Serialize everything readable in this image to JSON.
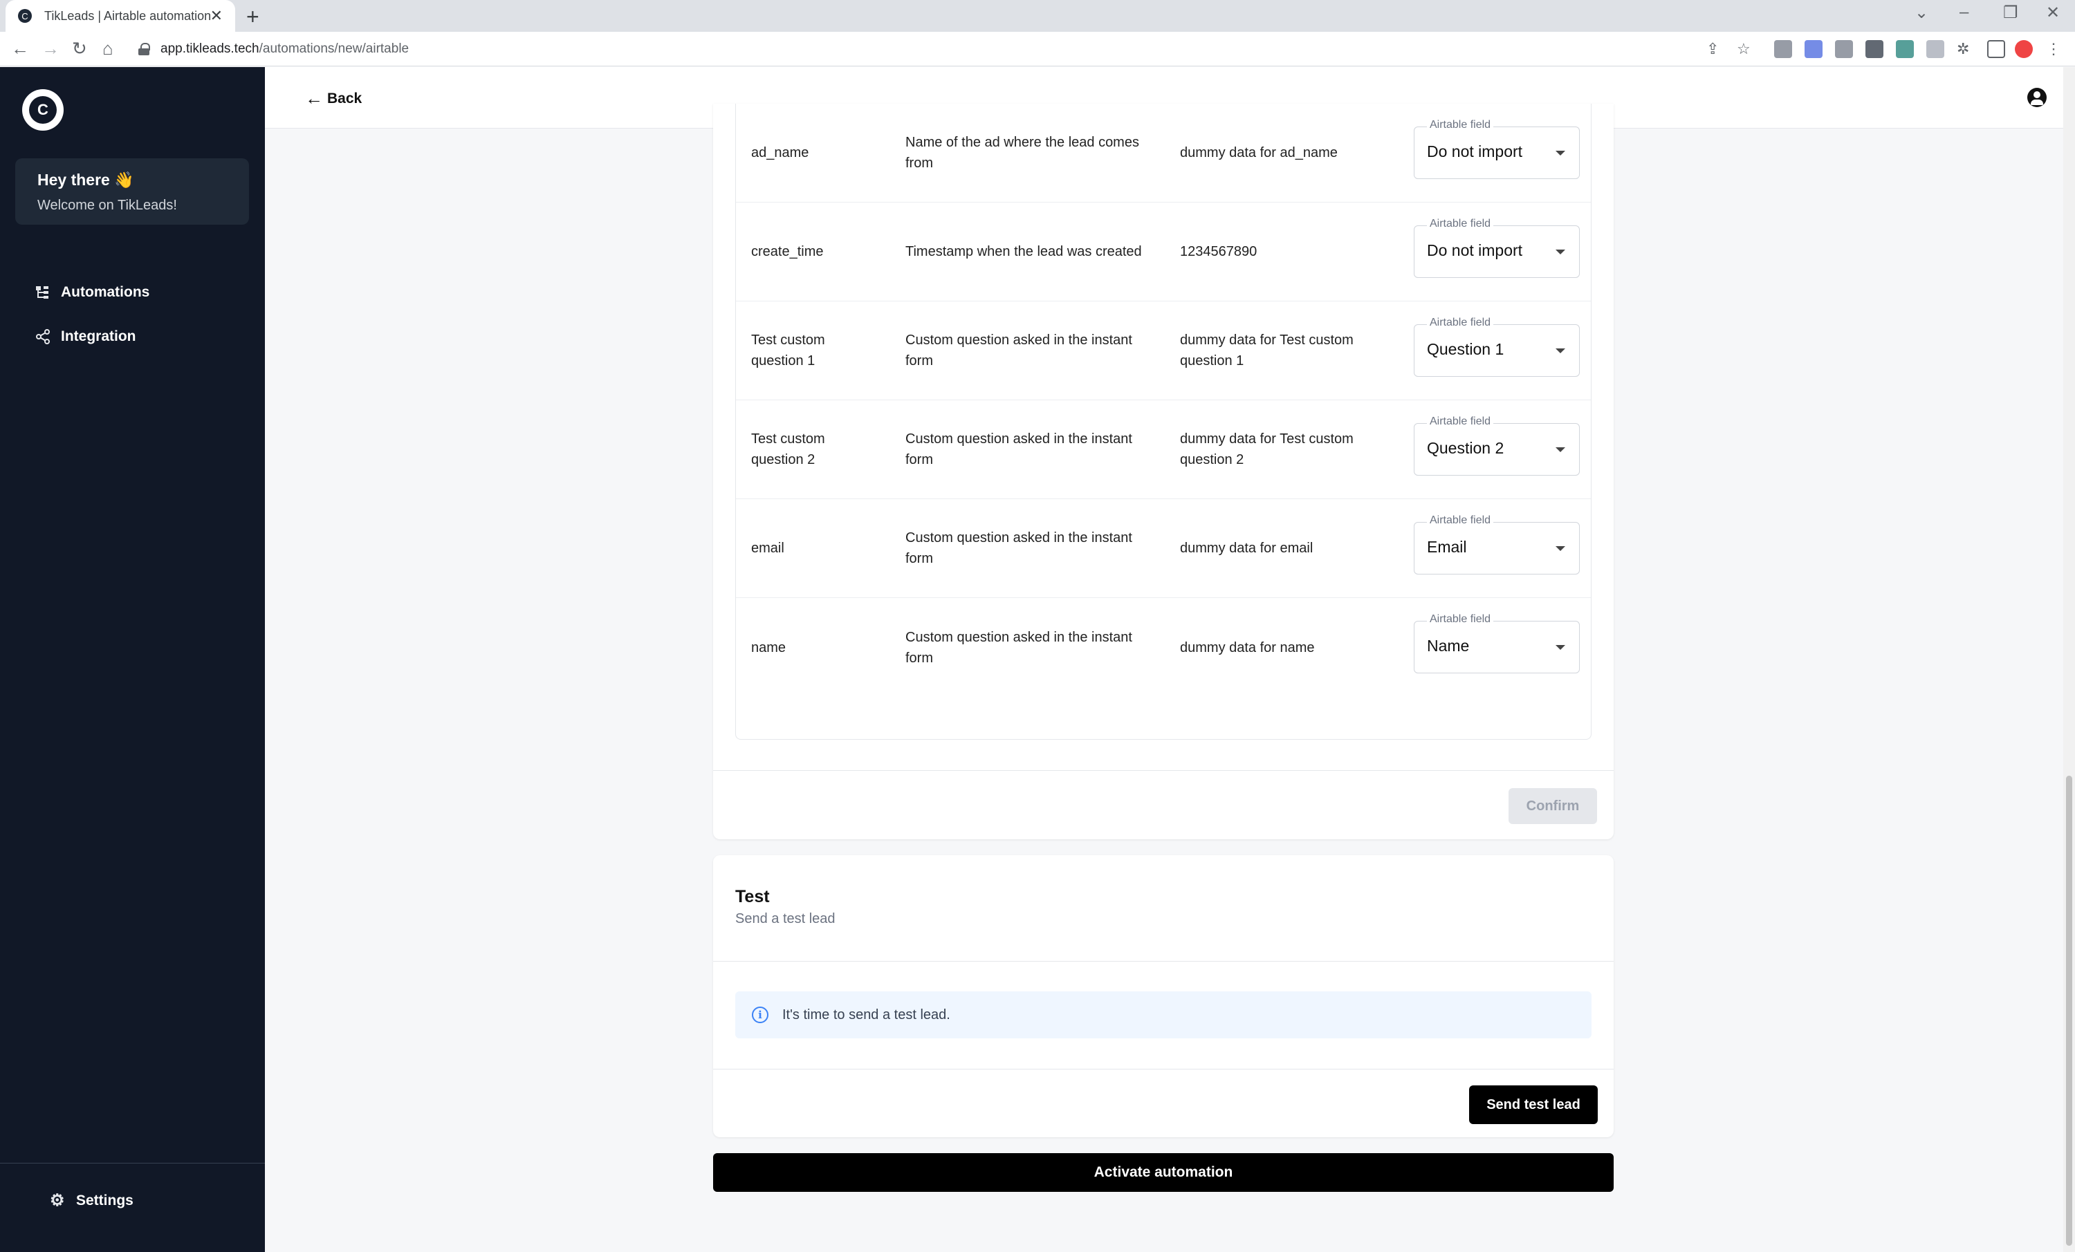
{
  "browser": {
    "tab_title": "TikLeads | Airtable automation",
    "url_host": "app.tikleads.tech",
    "url_path": "/automations/new/airtable"
  },
  "sidebar": {
    "greeting": "Hey there 👋",
    "welcome": "Welcome on TikLeads!",
    "items": [
      {
        "label": "Automations",
        "icon": "automations-icon"
      },
      {
        "label": "Integration",
        "icon": "share-icon"
      }
    ],
    "settings_label": "Settings"
  },
  "header": {
    "back_label": "Back"
  },
  "mapping": {
    "rows": [
      {
        "field": "ad_name",
        "description": "Name of the ad where the lead comes from",
        "dummy": "dummy data for ad_name",
        "select_label": "Airtable field",
        "select_value": "Do not import"
      },
      {
        "field": "create_time",
        "description": "Timestamp when the lead was created",
        "dummy": "1234567890",
        "select_label": "Airtable field",
        "select_value": "Do not import"
      },
      {
        "field": "Test custom question 1",
        "description": "Custom question asked in the instant form",
        "dummy": "dummy data for Test custom question 1",
        "select_label": "Airtable field",
        "select_value": "Question 1"
      },
      {
        "field": "Test custom question 2",
        "description": "Custom question asked in the instant form",
        "dummy": "dummy data for Test custom question 2",
        "select_label": "Airtable field",
        "select_value": "Question 2"
      },
      {
        "field": "email",
        "description": "Custom question asked in the instant form",
        "dummy": "dummy data for email",
        "select_label": "Airtable field",
        "select_value": "Email"
      },
      {
        "field": "name",
        "description": "Custom question asked in the instant form",
        "dummy": "dummy data for name",
        "select_label": "Airtable field",
        "select_value": "Name"
      }
    ],
    "confirm_label": "Confirm"
  },
  "test": {
    "title": "Test",
    "subtitle": "Send a test lead",
    "info": "It's time to send a test lead.",
    "send_label": "Send test lead"
  },
  "activate_label": "Activate automation"
}
